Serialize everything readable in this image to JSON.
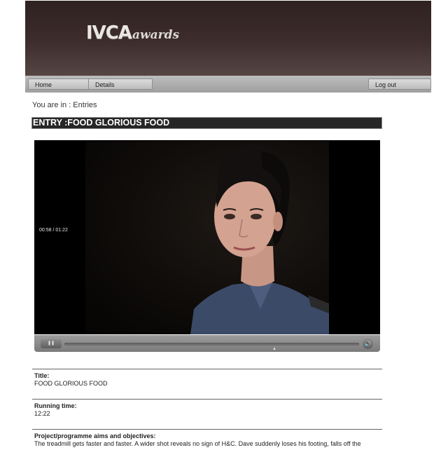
{
  "header": {
    "logo_main": "IVCA",
    "logo_sub": "awards"
  },
  "nav": {
    "home_label": "Home",
    "details_label": "Details",
    "logout_label": "Log out"
  },
  "breadcrumb": "You are in : Entries",
  "entry_heading": "ENTRY :FOOD GLORIOUS FOOD",
  "player": {
    "time_display": "00:58 / 01:22",
    "pause_glyph": "❚❚",
    "volume_glyph": "🔊",
    "seek_marker_glyph": "▲"
  },
  "fields": {
    "title": {
      "label": "Title:",
      "value": "FOOD GLORIOUS FOOD"
    },
    "running_time": {
      "label": "Running time:",
      "value": "12:22"
    },
    "aims": {
      "label": "Project/programme aims and objectives:",
      "value": "The treadmill gets faster and faster. A wider shot reveals no sign of H&C. Dave suddenly loses his footing, falls off the"
    }
  },
  "colors": {
    "header_top": "#2e2120",
    "title_bar": "#262626",
    "nav_bar": "#a8a8a8"
  }
}
